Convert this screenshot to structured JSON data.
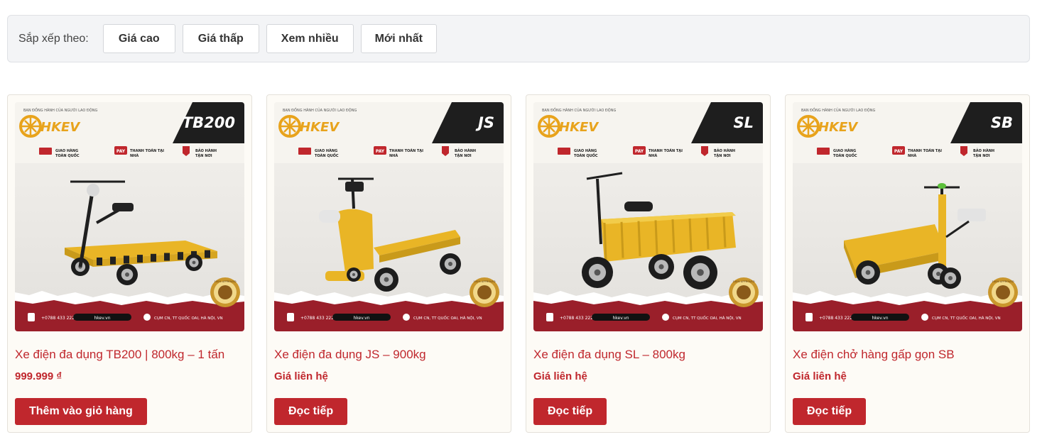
{
  "sort": {
    "label": "Sắp xếp theo:",
    "options": [
      "Giá cao",
      "Giá thấp",
      "Xem nhiều",
      "Mới nhất"
    ]
  },
  "brand": {
    "logo_text": "HKEV",
    "tagline": "BẠN ĐỒNG HÀNH CỦA NGƯỜI LAO ĐỘNG",
    "feature_1_line1": "GIAO HÀNG",
    "feature_1_line2": "TOÀN QUỐC",
    "feature_2_line1": "THANH TOÁN TẠI",
    "feature_2_line2": "NHÀ",
    "feature_3_line1": "BẢO HÀNH",
    "feature_3_line2": "TẬN NƠI",
    "pay_badge": "PAY",
    "phone": "+0788 433 222",
    "website": "hkev.vn",
    "address": "CỤM CN, TT QUỐC OAI, HÀ NỘI, VN",
    "seal_text": "100% APPROVED"
  },
  "colors": {
    "accent": "#c0272d",
    "banner_red": "#9a1f2a",
    "vehicle_yellow": "#e9b526",
    "logo_gold": "#e8a31c"
  },
  "products": [
    {
      "code": "TB200",
      "title": "Xe điện đa dụng TB200 | 800kg – 1 tấn",
      "price": "999.999 ₫",
      "button": "Thêm vào giỏ hàng",
      "style": "tb200"
    },
    {
      "code": "JS",
      "title": "Xe điện đa dụng JS – 900kg",
      "price": "Giá liên hệ",
      "button": "Đọc tiếp",
      "style": "js"
    },
    {
      "code": "SL",
      "title": "Xe điện đa dụng SL – 800kg",
      "price": "Giá liên hệ",
      "button": "Đọc tiếp",
      "style": "sl"
    },
    {
      "code": "SB",
      "title": "Xe điện chở hàng gấp gọn SB",
      "price": "Giá liên hệ",
      "button": "Đọc tiếp",
      "style": "sb"
    }
  ]
}
